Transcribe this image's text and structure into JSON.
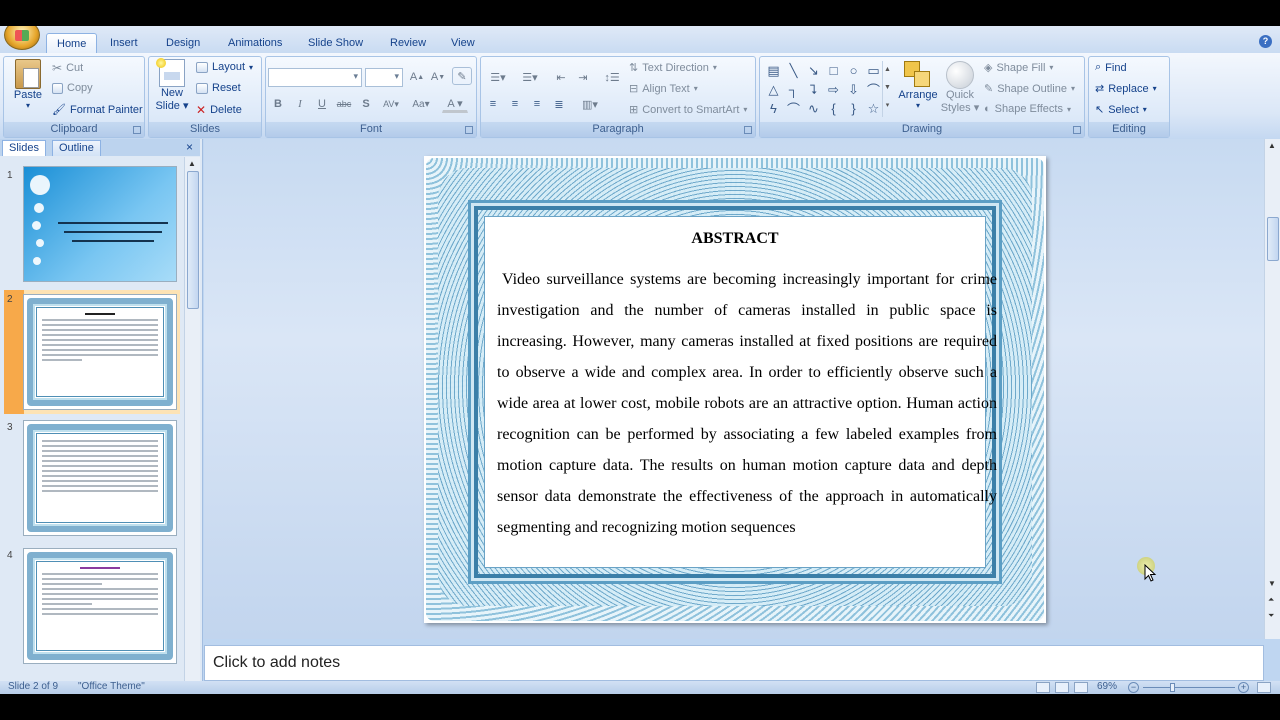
{
  "tabs": [
    "Home",
    "Insert",
    "Design",
    "Animations",
    "Slide Show",
    "Review",
    "View"
  ],
  "clipboard": {
    "paste": "Paste",
    "cut": "Cut",
    "copy": "Copy",
    "format_painter": "Format Painter",
    "label": "Clipboard"
  },
  "slides_group": {
    "new_slide_1": "New",
    "new_slide_2": "Slide",
    "layout": "Layout",
    "reset": "Reset",
    "delete": "Delete",
    "label": "Slides"
  },
  "font_group": {
    "label": "Font"
  },
  "paragraph_group": {
    "text_direction": "Text Direction",
    "align_text": "Align Text",
    "convert_smartart": "Convert to SmartArt",
    "label": "Paragraph"
  },
  "drawing_group": {
    "arrange": "Arrange",
    "quick_1": "Quick",
    "quick_2": "Styles",
    "shape_fill": "Shape Fill",
    "shape_outline": "Shape Outline",
    "shape_effects": "Shape Effects",
    "label": "Drawing"
  },
  "editing_group": {
    "find": "Find",
    "replace": "Replace",
    "select": "Select",
    "label": "Editing"
  },
  "pane": {
    "slides_tab": "Slides",
    "outline_tab": "Outline",
    "close": "×"
  },
  "slide_numbers": [
    "1",
    "2",
    "3",
    "4"
  ],
  "slide": {
    "title": "ABSTRACT",
    "body": "Video surveillance systems are becoming increasingly important for crime investigation and the number of cameras installed in public space is increasing. However, many cameras installed at fixed positions are required to observe a wide and complex area. In order to efficiently observe such a wide area at lower cost, mobile robots are an attractive option. Human action recognition can be performed by associating a few labeled examples from motion capture data. The results on human motion capture data and depth sensor data demonstrate the effectiveness of the approach in automatically segmenting and recognizing motion sequences"
  },
  "notes_placeholder": "Click to add notes",
  "status": {
    "slide_of": "Slide 2 of 9",
    "theme": "\"Office Theme\"",
    "zoom": "69%"
  }
}
